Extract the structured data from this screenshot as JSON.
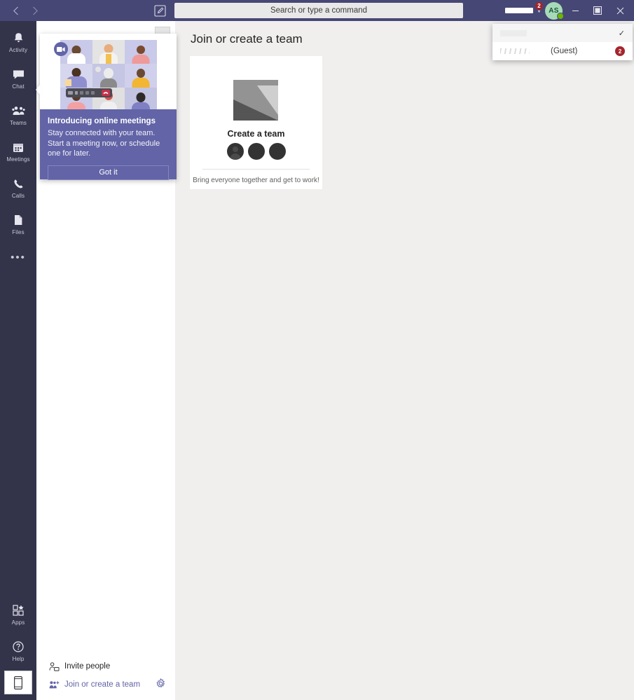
{
  "titlebar": {
    "back_icon": "chevron-left-icon",
    "forward_icon": "chevron-right-icon",
    "compose_icon": "compose-icon",
    "search_placeholder": "Search or type a command",
    "account_name": "",
    "account_badge": "2",
    "avatar_initials": "AS",
    "minimize_label": "—",
    "maximize_label": "☐",
    "close_label": "✕"
  },
  "account_dropdown": {
    "rows": [
      {
        "name": "",
        "label": "",
        "checked": "✓",
        "badge": ""
      },
      {
        "name": "",
        "label": "(Guest)",
        "checked": "",
        "badge": "2"
      }
    ]
  },
  "rail": {
    "items": [
      {
        "label": "Activity",
        "icon": "bell-icon"
      },
      {
        "label": "Chat",
        "icon": "chat-icon"
      },
      {
        "label": "Teams",
        "icon": "teams-icon"
      },
      {
        "label": "Meetings",
        "icon": "calendar-icon"
      },
      {
        "label": "Calls",
        "icon": "phone-icon"
      },
      {
        "label": "Files",
        "icon": "files-icon"
      }
    ],
    "overflow_label": "•••",
    "bottom_items": [
      {
        "label": "Apps",
        "icon": "apps-icon"
      },
      {
        "label": "Help",
        "icon": "help-icon"
      }
    ],
    "mobile_icon": "mobile-device-icon"
  },
  "teams_panel": {
    "invite_label": "Invite people",
    "invite_icon": "add-person-icon",
    "join_label": "Join or create a team",
    "join_icon": "people-add-icon",
    "settings_icon": "gear-icon"
  },
  "teaser": {
    "title": "Introducing online meetings",
    "description": "Stay connected with your team. Start a meeting now, or schedule one for later.",
    "button_label": "Got it",
    "camera_icon": "video-camera-icon",
    "hangup_icon": "hangup-icon"
  },
  "main": {
    "page_title": "Join or create a team",
    "create_card": {
      "title": "Create a team",
      "caption": "Bring everyone together and get to work!",
      "thumb_icon": "image-placeholder-icon"
    }
  },
  "colors": {
    "brand_purple": "#6264a7",
    "titlebar_purple": "#464775",
    "rail_dark": "#33344a",
    "badge_red": "#a4262c",
    "presence_green": "#6bb700",
    "canvas": "#f0efee"
  }
}
